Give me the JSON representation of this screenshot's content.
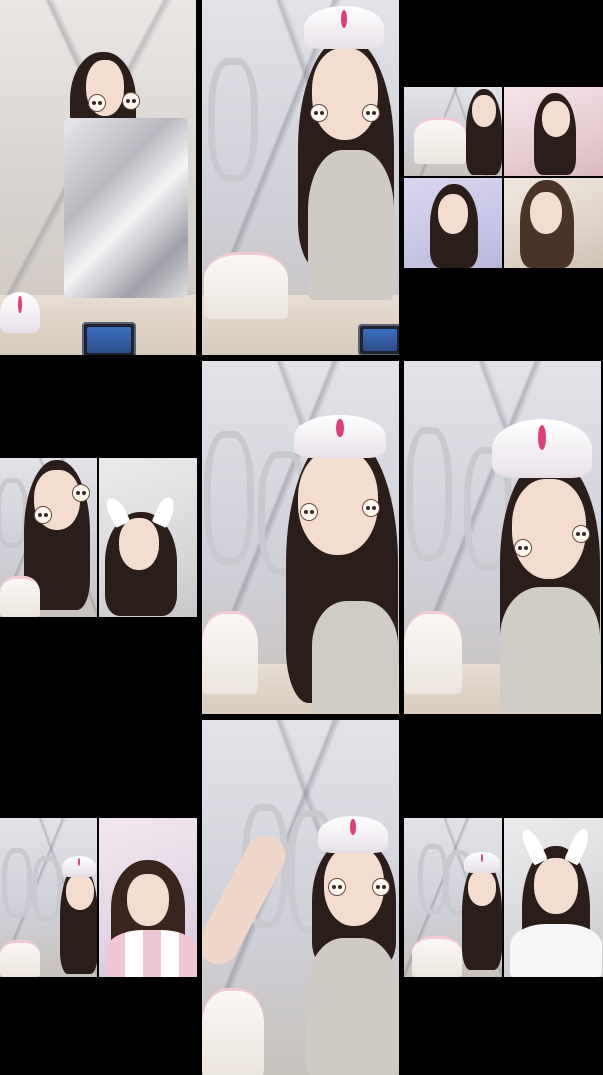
{
  "layout": {
    "grid_columns": 3,
    "grid_rows": 3,
    "background_color": "#000000"
  },
  "streams": [
    {
      "id": "cell-1",
      "kind": "single",
      "scene": "foil-gift"
    },
    {
      "id": "cell-2",
      "kind": "single",
      "scene": "waving-cake"
    },
    {
      "id": "cell-3",
      "kind": "quad",
      "scene": "four-way-call"
    },
    {
      "id": "cell-4",
      "kind": "duo",
      "scene": "two-way-call"
    },
    {
      "id": "cell-5",
      "kind": "single",
      "scene": "heart-hands"
    },
    {
      "id": "cell-6",
      "kind": "single",
      "scene": "tiara-looking-down"
    },
    {
      "id": "cell-7",
      "kind": "duo",
      "scene": "two-way-call"
    },
    {
      "id": "cell-8",
      "kind": "single",
      "scene": "arm-raised"
    },
    {
      "id": "cell-9",
      "kind": "duo",
      "scene": "two-way-call"
    }
  ],
  "colors": {
    "tiara_gem": "#e0407a",
    "hair": "#2a1d1a",
    "skin": "#f4dccf",
    "cake_frosting": "#f3c9d6",
    "sticker_face": "#fffaf2"
  },
  "icons": {
    "face_sticker": "bear-face-sticker-icon"
  }
}
